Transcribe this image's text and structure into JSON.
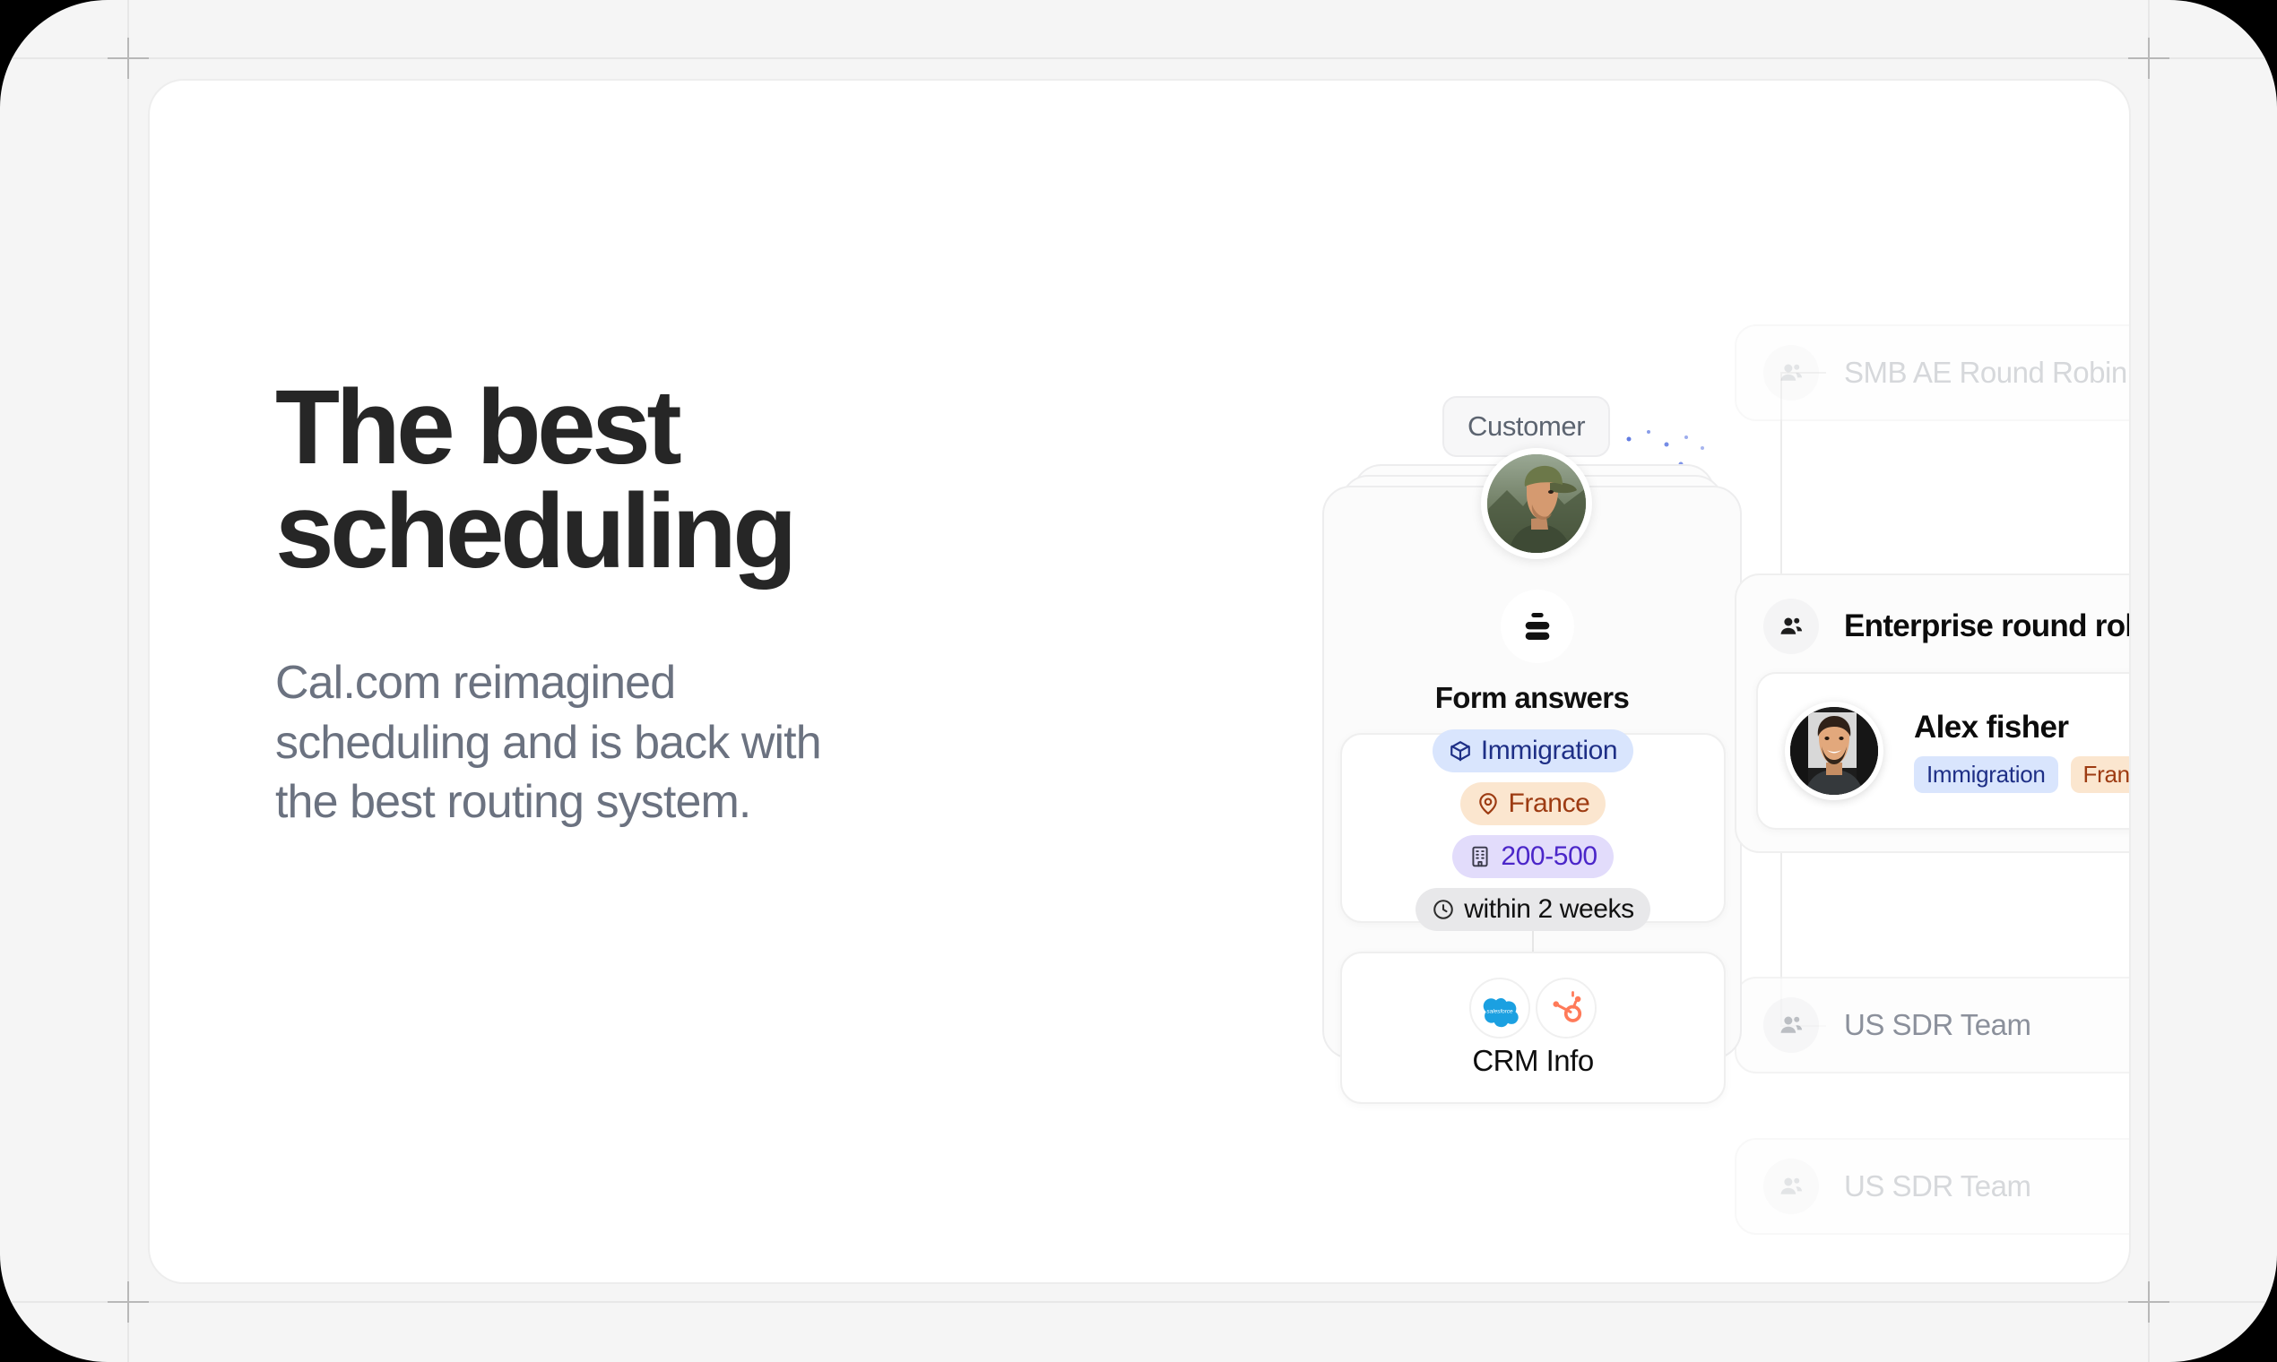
{
  "hero": {
    "headline": "The best\nscheduling",
    "subheadline": "Cal.com reimagined\nscheduling and is back with\nthe best routing system."
  },
  "flow": {
    "customer_pill": "Customer",
    "form": {
      "icon": "form-list-icon",
      "title": "Form answers",
      "answers": [
        {
          "icon": "box-icon",
          "label": "Immigration",
          "style": "blue"
        },
        {
          "icon": "location-icon",
          "label": "France",
          "style": "orange"
        },
        {
          "icon": "building-icon",
          "label": "200-500",
          "style": "purple"
        },
        {
          "icon": "clock-icon",
          "label": "within 2 weeks",
          "style": "grey"
        }
      ]
    },
    "crm": {
      "title": "CRM Info",
      "logos": [
        "salesforce-logo",
        "hubspot-logo"
      ]
    }
  },
  "routing": {
    "teams": [
      {
        "icon": "users-icon",
        "label": "SMB AE Round Robin"
      },
      {
        "icon": "users-icon",
        "label": "US SDR Team"
      },
      {
        "icon": "users-icon",
        "label": "US SDR Team"
      }
    ],
    "selected": {
      "icon": "users-icon",
      "title": "Enterprise round robin",
      "member": {
        "avatar": "alex-fisher-avatar",
        "name": "Alex fisher",
        "tags": [
          {
            "label": "Immigration",
            "style": "blue"
          },
          {
            "label": "France",
            "style": "orange"
          }
        ]
      },
      "status_icon": "check-icon"
    }
  },
  "colors": {
    "page_background": "#f5f5f5",
    "card_background": "#ffffff",
    "headline": "#262626",
    "subheadline": "#6b7280",
    "accent_blue": "#3b5bdb",
    "success_green": "#3dc78e",
    "tag_blue_bg": "#d9e5fd",
    "tag_blue_text": "#1e2f86",
    "tag_orange_bg": "#fbe6cf",
    "tag_orange_text": "#9d3b12",
    "tag_purple_bg": "#e2dcfb",
    "tag_purple_text": "#4b26c9",
    "tag_grey_bg": "#e8e8ea",
    "salesforce_blue": "#1bA0e1",
    "hubspot_orange": "#ff7a59"
  }
}
